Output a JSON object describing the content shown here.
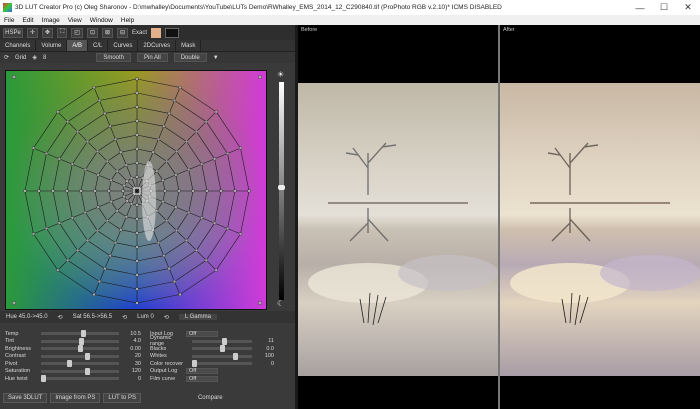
{
  "window": {
    "title": "3D LUT Creator Pro (c) Oleg Sharonov - D:\\mwhalley\\Documents\\YouTube\\LUTs Demo\\RWhalley_EMS_2014_12_C290840.tif (ProPhoto RGB v.2.10)* ICMS DISABLED",
    "minimize": "—",
    "maximize": "☐",
    "close": "✕"
  },
  "menu": [
    "File",
    "Edit",
    "Image",
    "View",
    "Window",
    "Help"
  ],
  "toolbar": {
    "mode": "HSPe",
    "tools": [
      "✛",
      "✥",
      "⛶",
      "◰",
      "⊡",
      "⊠",
      "⊟"
    ],
    "exact_label": "Exact"
  },
  "tabs": [
    "Channels",
    "Volume",
    "A/B",
    "C/L",
    "Curves",
    "2DCurves",
    "Mask"
  ],
  "active_tab": "A/B",
  "grid_controls": {
    "grid_label": "Grid",
    "grid_value": "8",
    "smooth": "Smooth",
    "pin_all": "Pin All",
    "double": "Double"
  },
  "footer": {
    "hue": "Hue 45.0->45.0",
    "sat": "Sat 56.5->56.5",
    "lum": "Lum 0",
    "gamma": "L  Gamma"
  },
  "adjust_left": [
    {
      "label": "Temp",
      "value": "10.5",
      "pos": 0.55
    },
    {
      "label": "Tint",
      "value": "4.0",
      "pos": 0.52
    },
    {
      "label": "Brightness",
      "value": "0.00",
      "pos": 0.5
    },
    {
      "label": "Contrast",
      "value": "20",
      "pos": 0.6
    },
    {
      "label": "Pivot",
      "value": "30",
      "pos": 0.35
    },
    {
      "label": "Saturation",
      "value": "120",
      "pos": 0.6
    },
    {
      "label": "Hue twist",
      "value": "0",
      "pos": 0.0
    }
  ],
  "adjust_right": [
    {
      "label": "Input Log",
      "kind": "dropdown",
      "value": "Off"
    },
    {
      "label": "Dynamic range",
      "kind": "slider",
      "value": "11",
      "pos": 0.55
    },
    {
      "label": "Blacks",
      "kind": "slider",
      "value": "0.0",
      "pos": 0.5
    },
    {
      "label": "Whites",
      "kind": "slider",
      "value": "100",
      "pos": 0.75
    },
    {
      "label": "Color recover",
      "kind": "slider",
      "value": "0",
      "pos": 0.0
    },
    {
      "label": "Output Log",
      "kind": "dropdown",
      "value": "Off"
    },
    {
      "label": "Film curve",
      "kind": "dropdown",
      "value": "Off"
    }
  ],
  "bottom_buttons": [
    "Save 3DLUT",
    "Image from PS",
    "LUT to PS",
    "Compare"
  ],
  "viewers": {
    "before": "Before",
    "after": "After"
  },
  "colors": {
    "accent_tab": "#555555",
    "panel_bg": "#3a3a3a"
  }
}
